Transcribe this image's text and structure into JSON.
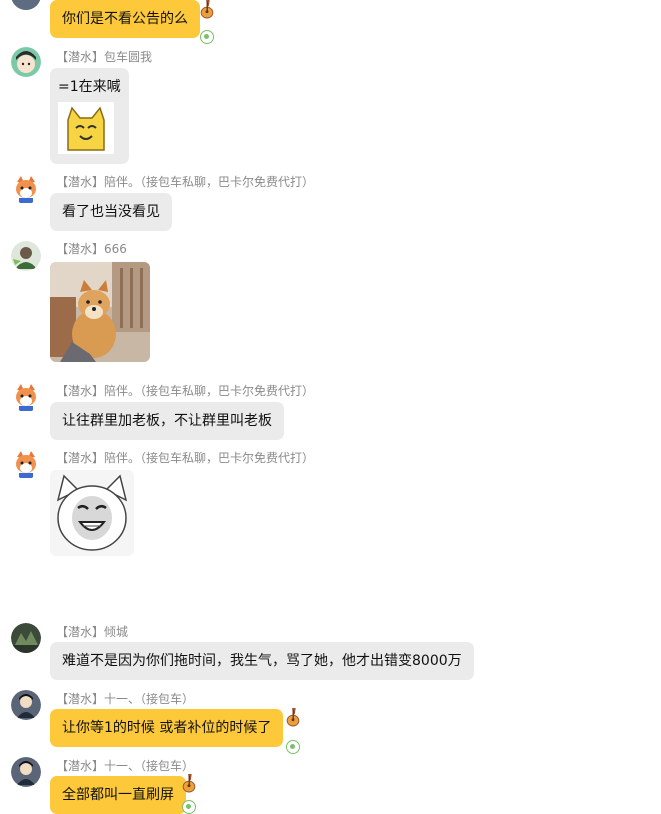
{
  "colors": {
    "self_bubble": "#fdc93a",
    "other_bubble": "#ebebeb",
    "sender_name": "#8a8a8a"
  },
  "messages": [
    {
      "side": "self",
      "bubble": "你们是不看公告的么"
    },
    {
      "side": "other",
      "sender": "【潜水】包车圆我",
      "bubble": "=1在来喊",
      "sticker": "yellow-cat-sticker"
    },
    {
      "side": "other",
      "sender": "【潜水】陪伴。（接包车私聊，巴卡尔免费代打）",
      "bubble": "看了也当没看见"
    },
    {
      "side": "other",
      "sender": "【潜水】666",
      "image": "shiba-dog-photo"
    },
    {
      "side": "other",
      "sender": "【潜水】陪伴。（接包车私聊，巴卡尔免费代打）",
      "bubble": "让往群里加老板，不让群里叫老板"
    },
    {
      "side": "other",
      "sender": "【潜水】陪伴。（接包车私聊，巴卡尔免费代打）",
      "sticker": "laughing-face-sticker"
    },
    {
      "side": "other",
      "sender": "【潜水】倾城",
      "bubble": "难道不是因为你们拖时间，我生气，骂了她，他才出错变8000万"
    },
    {
      "side": "other",
      "sender": "【潜水】十一、（接包车）",
      "bubble": "让你等1的时候 或者补位的时候了"
    },
    {
      "side": "other",
      "sender": "【潜水】十一、（接包车）",
      "bubble": "全部都叫一直刷屏"
    }
  ]
}
